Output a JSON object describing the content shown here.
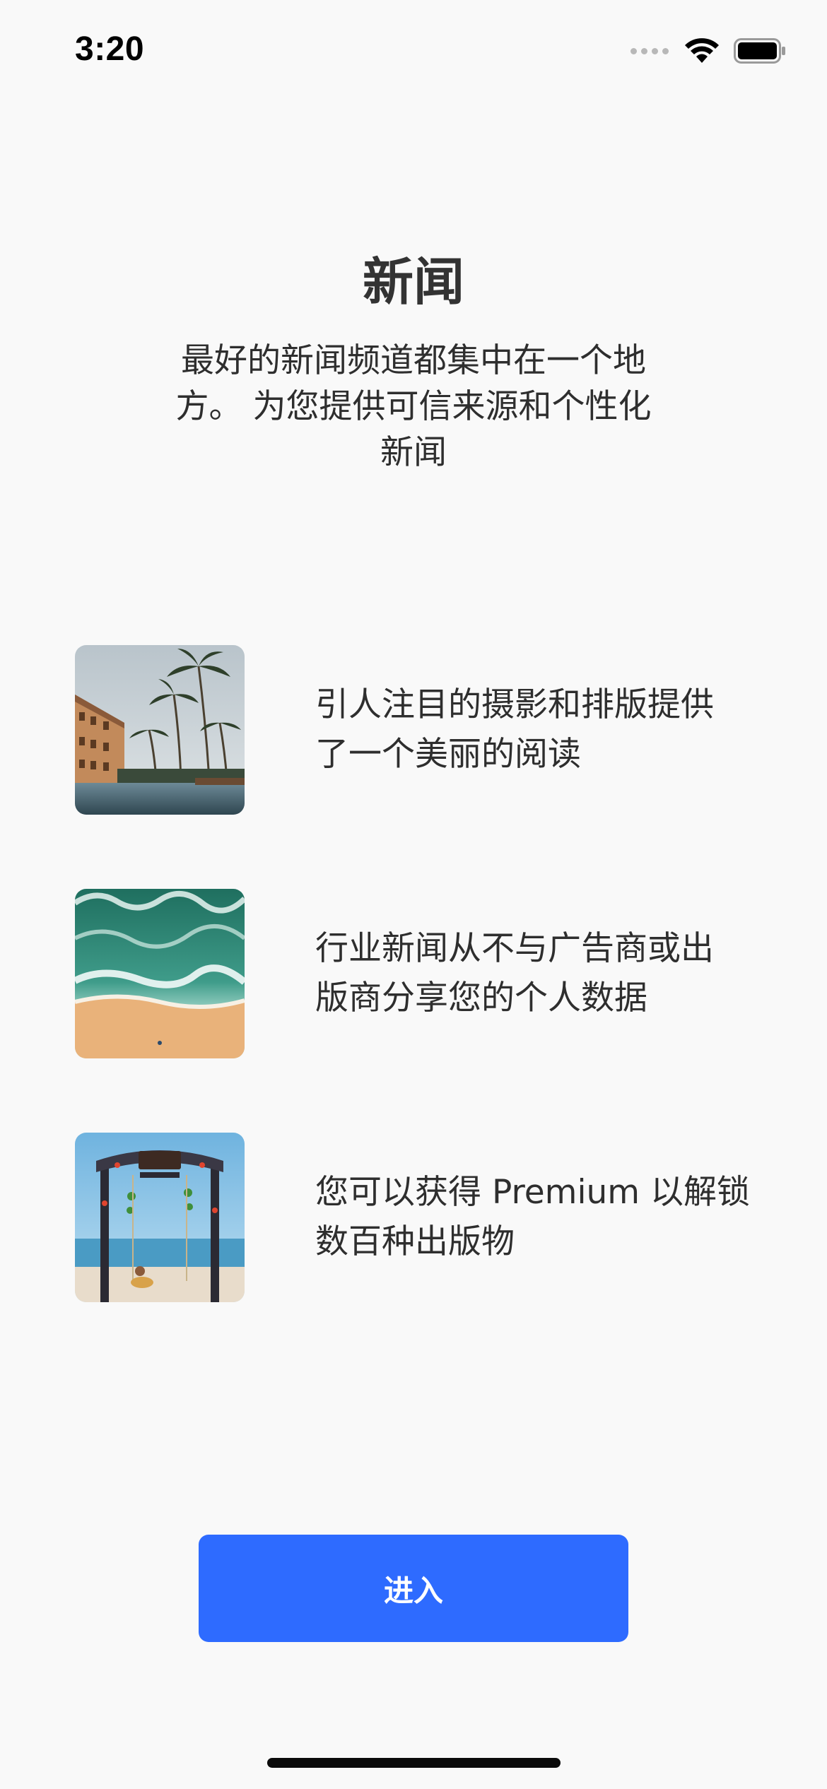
{
  "status_bar": {
    "time": "3:20",
    "icons": [
      "signal-dots-icon",
      "wifi-icon",
      "battery-icon"
    ]
  },
  "header": {
    "title": "新闻",
    "subtitle_lines": [
      "最好的新闻频道都集中在一个地",
      "方。 为您提供可信来源和个性化",
      "新闻"
    ]
  },
  "features": [
    {
      "image": "resort-palm-trees-pool-photo",
      "text_lines": [
        "引人注目的摄影和排版提供",
        "了一个美丽的阅读"
      ]
    },
    {
      "image": "aerial-beach-waves-photo",
      "text_lines": [
        "行业新闻从不与广告商或出",
        "版商分享您的个人数据"
      ]
    },
    {
      "image": "beach-swing-arch-photo",
      "text_lines": [
        "您可以获得 Premium 以解锁",
        "数百种出版物"
      ]
    }
  ],
  "actions": {
    "enter_label": "进入"
  },
  "colors": {
    "background": "#f9f9f9",
    "accent": "#2e6bff",
    "text": "#2e2e2e"
  }
}
